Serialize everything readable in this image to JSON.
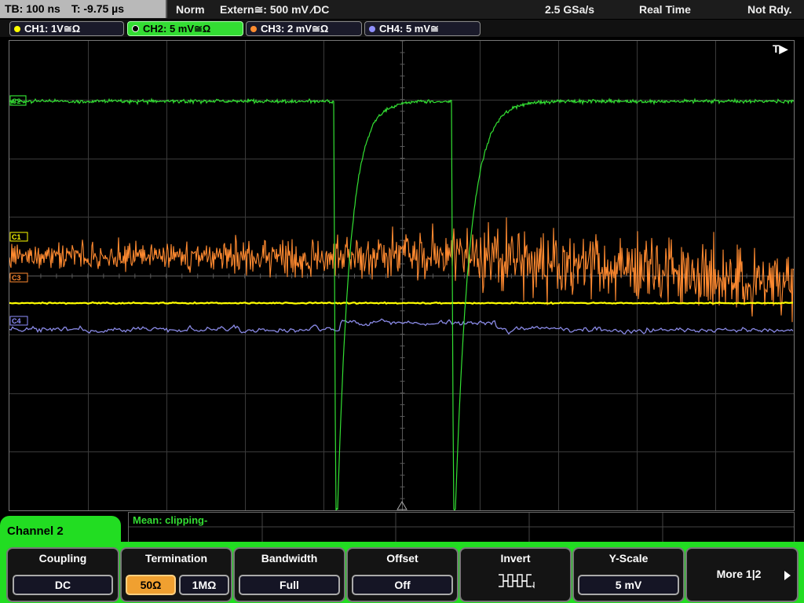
{
  "statusbar": {
    "timebase": "TB: 100 ns",
    "trigger_time": "T: -9.75 µs",
    "trigger_mode": "Norm",
    "trigger_source": "Extern≅: 500 mV ⁄DC",
    "sample_rate": "2.5 GSa/s",
    "acq_mode": "Real Time",
    "state": "Not Rdy."
  },
  "channels": [
    {
      "label": "CH1: 1V≅Ω",
      "color": "#ffff00"
    },
    {
      "label": "CH2: 5 mV≅Ω",
      "color": "#33dd33",
      "active": true
    },
    {
      "label": "CH3: 2 mV≅Ω",
      "color": "#ff8c30"
    },
    {
      "label": "CH4: 5 mV≅",
      "color": "#9090ff"
    }
  ],
  "markers": {
    "c2": "C2",
    "c1": "C1",
    "c3": "C3",
    "c4": "C4",
    "trigger": "T▶"
  },
  "info": {
    "measurement": "Mean: clipping-"
  },
  "menu": {
    "title": "Channel 2",
    "coupling": {
      "label": "Coupling",
      "value": "DC"
    },
    "termination": {
      "label": "Termination",
      "opt1": "50Ω",
      "opt2": "1MΩ",
      "selected": "50Ω"
    },
    "bandwidth": {
      "label": "Bandwidth",
      "value": "Full"
    },
    "offset": {
      "label": "Offset",
      "value": "Off"
    },
    "invert": {
      "label": "Invert",
      "icon": "invert-waveform-icon"
    },
    "yscale": {
      "label": "Y-Scale",
      "value": "5 mV"
    },
    "more": {
      "label": "More 1|2",
      "icon": "arrow-right-icon"
    }
  }
}
